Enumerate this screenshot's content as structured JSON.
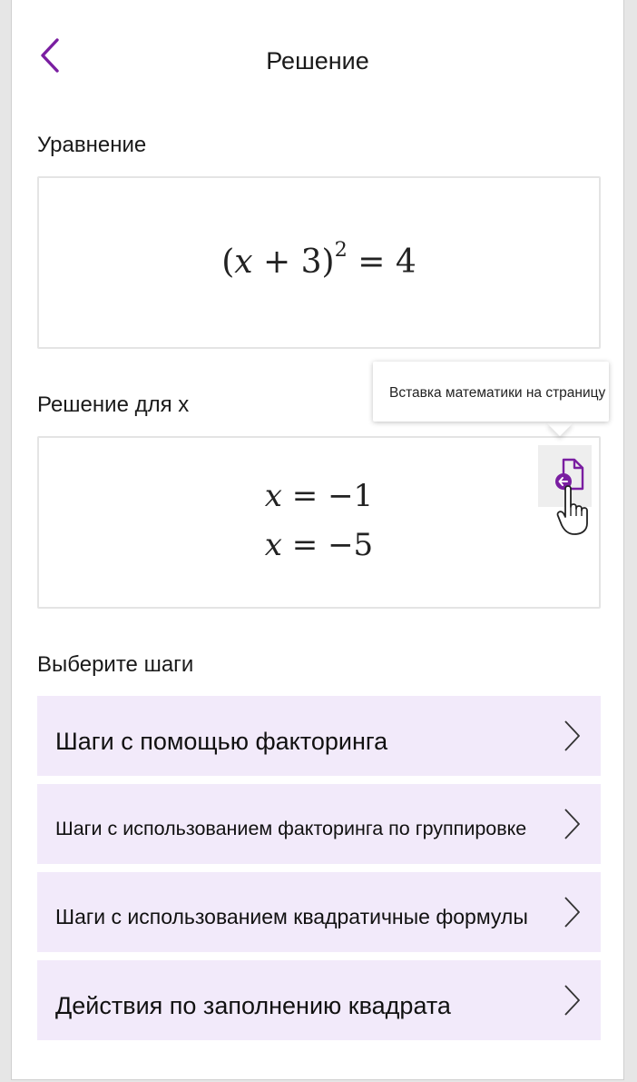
{
  "header": {
    "title": "Решение",
    "back_icon": "chevron-left-icon"
  },
  "colors": {
    "accent": "#7a1ea1",
    "step_background": "#f2eafa",
    "button_background": "#eeeeee"
  },
  "equation": {
    "label": "Уравнение",
    "expression": "(x + 3)² = 4"
  },
  "solution": {
    "label": "Решение для x",
    "lines": [
      "x = −1",
      "x = −5"
    ],
    "insert_icon": "insert-math-document-icon",
    "tooltip": "Вставка математики на страницу"
  },
  "steps": {
    "label": "Выберите шаги",
    "items": [
      {
        "label": "Шаги с помощью факторинга"
      },
      {
        "label": "Шаги с использованием факторинга по группировке"
      },
      {
        "label": "Шаги с использованием квадратичные формулы"
      },
      {
        "label": "Действия по заполнению квадрата"
      }
    ],
    "chevron_icon": "chevron-right-icon"
  }
}
